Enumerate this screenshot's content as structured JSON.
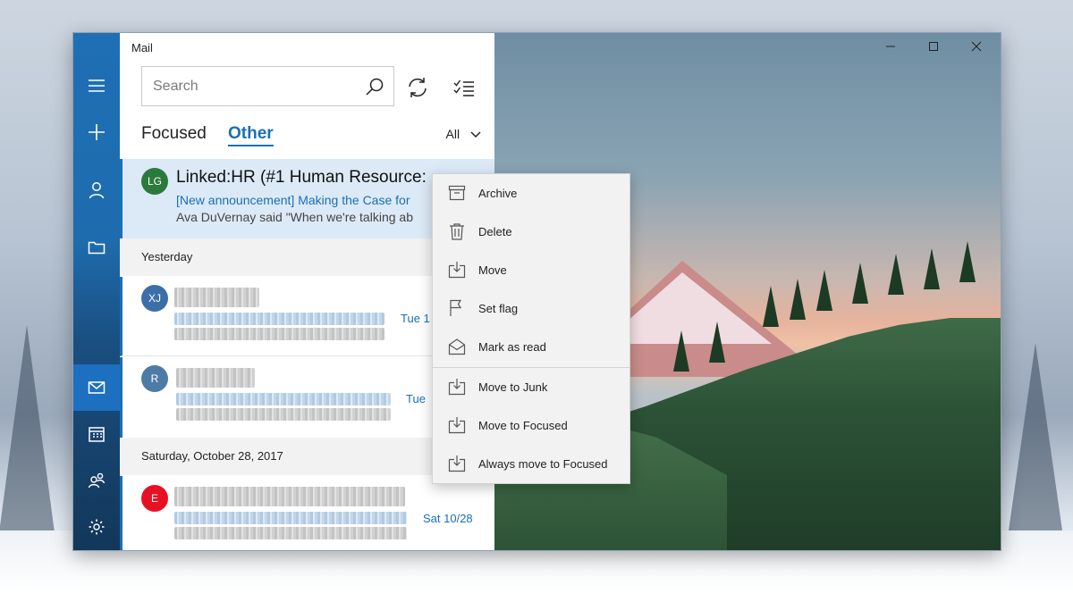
{
  "app": {
    "title": "Mail"
  },
  "search": {
    "placeholder": "Search"
  },
  "tabs": [
    {
      "label": "Focused",
      "active": false
    },
    {
      "label": "Other",
      "active": true
    }
  ],
  "filter": {
    "label": "All"
  },
  "messages": [
    {
      "initials": "LG",
      "avatar_color": "#2b7a3c",
      "sender": "Linked:HR (#1 Human Resource:",
      "subject": "[New announcement] Making the Case for",
      "preview": "Ava DuVernay said \"When we're talking ab",
      "date": ""
    }
  ],
  "groups": [
    {
      "heading": "Yesterday",
      "messages": [
        {
          "initials": "XJ",
          "avatar_color": "#3c6fa8",
          "date": "Tue 1"
        },
        {
          "initials": "R",
          "avatar_color": "#4d7ba8",
          "date": "Tue"
        }
      ]
    },
    {
      "heading": "Saturday, October 28, 2017",
      "messages": [
        {
          "initials": "E",
          "avatar_color": "#e81123",
          "date": "Sat 10/28"
        }
      ]
    }
  ],
  "context_menu": [
    {
      "label": "Archive",
      "icon": "archive-icon"
    },
    {
      "label": "Delete",
      "icon": "trash-icon"
    },
    {
      "label": "Move",
      "icon": "move-icon"
    },
    {
      "label": "Set flag",
      "icon": "flag-icon"
    },
    {
      "label": "Mark as read",
      "icon": "envelope-open-icon"
    },
    {
      "label": "Move to Junk",
      "icon": "move-icon"
    },
    {
      "label": "Move to Focused",
      "icon": "move-icon"
    },
    {
      "label": "Always move to Focused",
      "icon": "move-icon"
    }
  ],
  "colors": {
    "accent": "#1a6fb5",
    "rail": "#1f6fb5",
    "selected_bg": "#dceaf7"
  }
}
